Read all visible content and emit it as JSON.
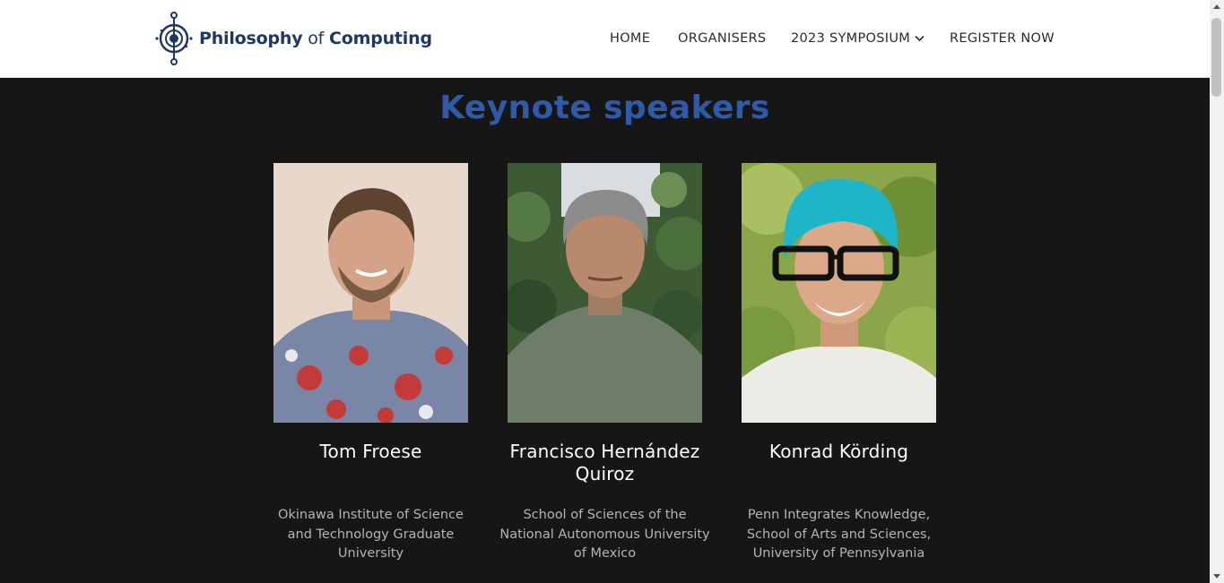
{
  "header": {
    "logo": {
      "name_bold_1": "Philosophy",
      "name_light": " of ",
      "name_bold_2": "Computing",
      "icon": "circuit-eye-icon"
    },
    "nav": {
      "home": "HOME",
      "organisers": "ORGANISERS",
      "symposium": "2023 SYMPOSIUM",
      "register": "REGISTER NOW"
    }
  },
  "main": {
    "section_title": "Keynote speakers",
    "speakers": [
      {
        "name": "Tom Froese",
        "affiliation": "Okinawa Institute of Science and Technology Graduate University"
      },
      {
        "name": "Francisco Hernández Quiroz",
        "affiliation": "School of Sciences of the National Autonomous University of Mexico"
      },
      {
        "name": "Konrad Körding",
        "affiliation": "Penn Integrates Knowledge, School of Arts and Sciences, University of Pennsylvania"
      }
    ]
  },
  "colors": {
    "accent_blue": "#2f5aa7",
    "logo_navy": "#1d3766",
    "background": "#161616"
  }
}
